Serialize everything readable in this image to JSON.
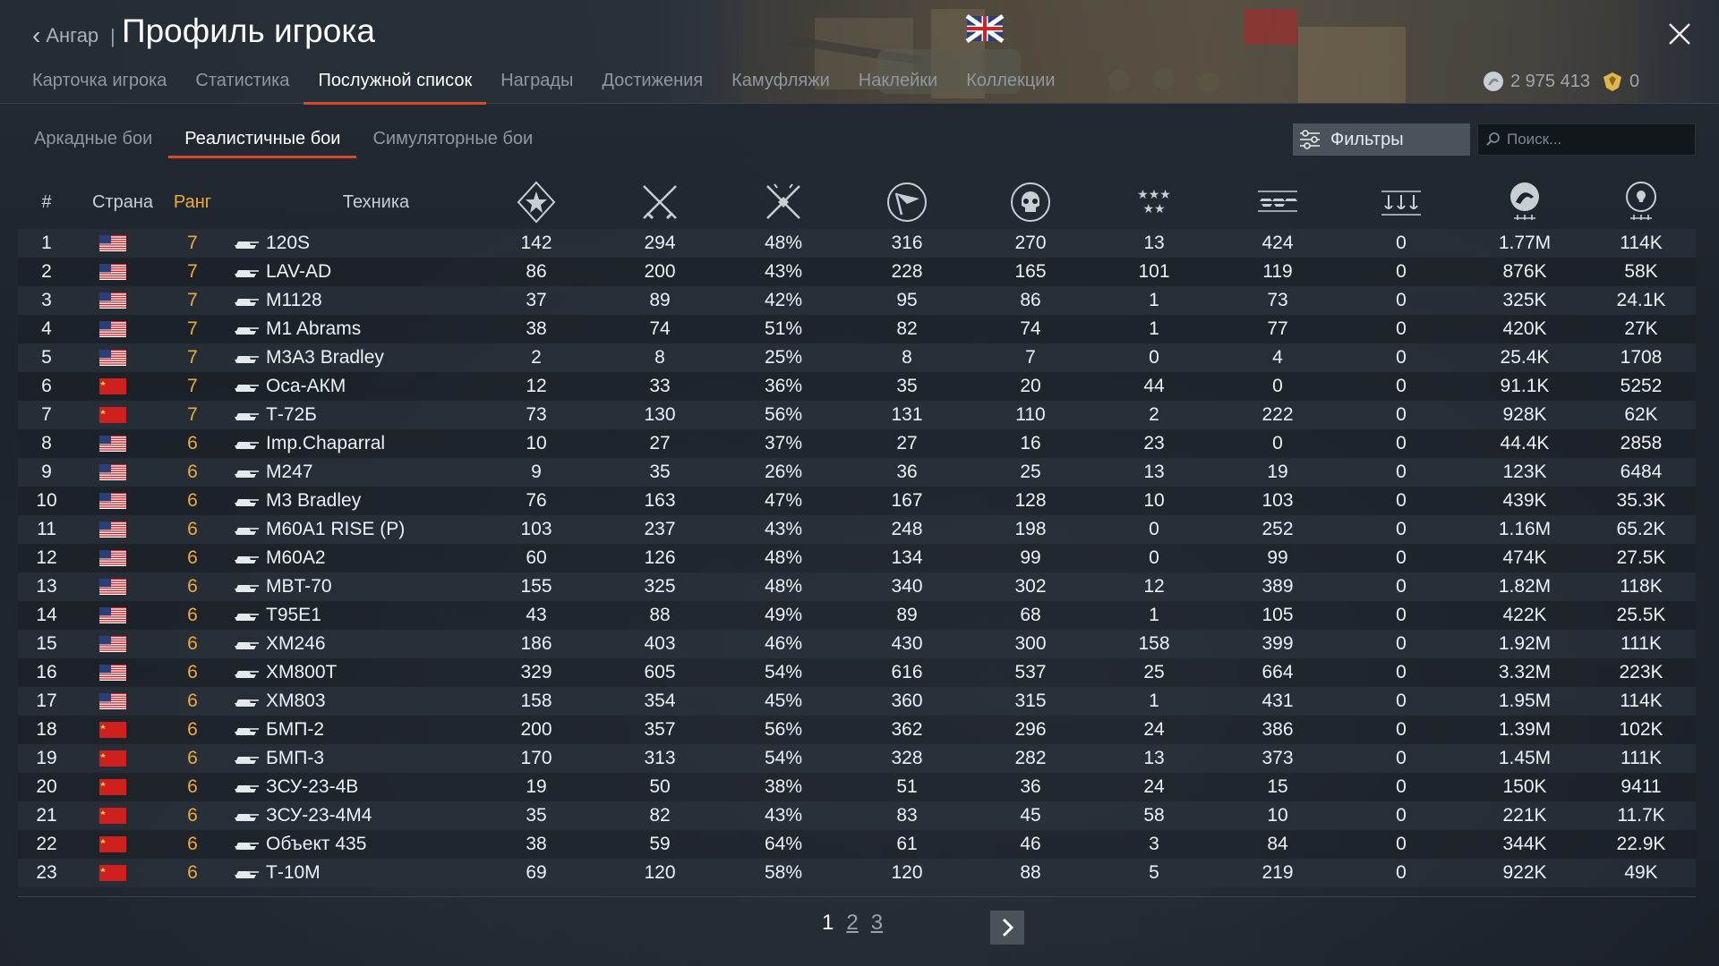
{
  "header": {
    "back_label": "Ангар",
    "separator": "|",
    "title": "Профиль игрока",
    "tabs": [
      {
        "label": "Карточка игрока",
        "active": false
      },
      {
        "label": "Статистика",
        "active": false
      },
      {
        "label": "Послужной список",
        "active": true
      },
      {
        "label": "Награды",
        "active": false
      },
      {
        "label": "Достижения",
        "active": false
      },
      {
        "label": "Камуфляжи",
        "active": false
      },
      {
        "label": "Наклейки",
        "active": false
      },
      {
        "label": "Коллекции",
        "active": false
      }
    ],
    "silver_lions": "2 975 413",
    "golden_eagles": "0"
  },
  "subtabs": [
    {
      "label": "Аркадные бои",
      "active": false
    },
    {
      "label": "Реалистичные бои",
      "active": true
    },
    {
      "label": "Симуляторные бои",
      "active": false
    }
  ],
  "filters_label": "Фильтры",
  "search_placeholder": "Поиск...",
  "columns": {
    "num": "#",
    "country": "Страна",
    "rank": "Ранг",
    "vehicle": "Техника",
    "stat_icons": [
      "missions-star-icon",
      "crossed-swords-icon",
      "winrate-swords-icon",
      "respawns-flag-icon",
      "deaths-skull-icon",
      "air-kills-stars-icon",
      "ground-kills-tanks-icon",
      "naval-kills-anchors-icon",
      "silver-lions-icon",
      "research-points-icon"
    ]
  },
  "rows": [
    {
      "n": "1",
      "country": "usa",
      "rank": "7",
      "name": "120S",
      "v": [
        "142",
        "294",
        "48%",
        "316",
        "270",
        "13",
        "424",
        "0",
        "1.77M",
        "114K"
      ]
    },
    {
      "n": "2",
      "country": "usa",
      "rank": "7",
      "name": "LAV-AD",
      "v": [
        "86",
        "200",
        "43%",
        "228",
        "165",
        "101",
        "119",
        "0",
        "876K",
        "58K"
      ]
    },
    {
      "n": "3",
      "country": "usa",
      "rank": "7",
      "name": "M1128",
      "v": [
        "37",
        "89",
        "42%",
        "95",
        "86",
        "1",
        "73",
        "0",
        "325K",
        "24.1K"
      ]
    },
    {
      "n": "4",
      "country": "usa",
      "rank": "7",
      "name": "M1 Abrams",
      "v": [
        "38",
        "74",
        "51%",
        "82",
        "74",
        "1",
        "77",
        "0",
        "420K",
        "27K"
      ]
    },
    {
      "n": "5",
      "country": "usa",
      "rank": "7",
      "name": "M3A3 Bradley",
      "v": [
        "2",
        "8",
        "25%",
        "8",
        "7",
        "0",
        "4",
        "0",
        "25.4K",
        "1708"
      ]
    },
    {
      "n": "6",
      "country": "ussr",
      "rank": "7",
      "name": "Оса-АКМ",
      "v": [
        "12",
        "33",
        "36%",
        "35",
        "20",
        "44",
        "0",
        "0",
        "91.1K",
        "5252"
      ]
    },
    {
      "n": "7",
      "country": "ussr",
      "rank": "7",
      "name": "Т-72Б",
      "v": [
        "73",
        "130",
        "56%",
        "131",
        "110",
        "2",
        "222",
        "0",
        "928K",
        "62K"
      ]
    },
    {
      "n": "8",
      "country": "usa",
      "rank": "6",
      "name": "Imp.Chaparral",
      "v": [
        "10",
        "27",
        "37%",
        "27",
        "16",
        "23",
        "0",
        "0",
        "44.4K",
        "2858"
      ]
    },
    {
      "n": "9",
      "country": "usa",
      "rank": "6",
      "name": "M247",
      "v": [
        "9",
        "35",
        "26%",
        "36",
        "25",
        "13",
        "19",
        "0",
        "123K",
        "6484"
      ]
    },
    {
      "n": "10",
      "country": "usa",
      "rank": "6",
      "name": "M3 Bradley",
      "v": [
        "76",
        "163",
        "47%",
        "167",
        "128",
        "10",
        "103",
        "0",
        "439K",
        "35.3K"
      ]
    },
    {
      "n": "11",
      "country": "usa",
      "rank": "6",
      "name": "M60A1 RISE (P)",
      "v": [
        "103",
        "237",
        "43%",
        "248",
        "198",
        "0",
        "252",
        "0",
        "1.16M",
        "65.2K"
      ]
    },
    {
      "n": "12",
      "country": "usa",
      "rank": "6",
      "name": "M60A2",
      "v": [
        "60",
        "126",
        "48%",
        "134",
        "99",
        "0",
        "99",
        "0",
        "474K",
        "27.5K"
      ]
    },
    {
      "n": "13",
      "country": "usa",
      "rank": "6",
      "name": "MBT-70",
      "v": [
        "155",
        "325",
        "48%",
        "340",
        "302",
        "12",
        "389",
        "0",
        "1.82M",
        "118K"
      ]
    },
    {
      "n": "14",
      "country": "usa",
      "rank": "6",
      "name": "T95E1",
      "v": [
        "43",
        "88",
        "49%",
        "89",
        "68",
        "1",
        "105",
        "0",
        "422K",
        "25.5K"
      ]
    },
    {
      "n": "15",
      "country": "usa",
      "rank": "6",
      "name": "XM246",
      "v": [
        "186",
        "403",
        "46%",
        "430",
        "300",
        "158",
        "399",
        "0",
        "1.92M",
        "111K"
      ]
    },
    {
      "n": "16",
      "country": "usa",
      "rank": "6",
      "name": "XM800T",
      "v": [
        "329",
        "605",
        "54%",
        "616",
        "537",
        "25",
        "664",
        "0",
        "3.32M",
        "223K"
      ]
    },
    {
      "n": "17",
      "country": "usa",
      "rank": "6",
      "name": "XM803",
      "v": [
        "158",
        "354",
        "45%",
        "360",
        "315",
        "1",
        "431",
        "0",
        "1.95M",
        "114K"
      ]
    },
    {
      "n": "18",
      "country": "ussr",
      "rank": "6",
      "name": "БМП-2",
      "v": [
        "200",
        "357",
        "56%",
        "362",
        "296",
        "24",
        "386",
        "0",
        "1.39M",
        "102K"
      ]
    },
    {
      "n": "19",
      "country": "ussr",
      "rank": "6",
      "name": "БМП-3",
      "v": [
        "170",
        "313",
        "54%",
        "328",
        "282",
        "13",
        "373",
        "0",
        "1.45M",
        "111K"
      ]
    },
    {
      "n": "20",
      "country": "ussr",
      "rank": "6",
      "name": "ЗСУ-23-4В",
      "v": [
        "19",
        "50",
        "38%",
        "51",
        "36",
        "24",
        "15",
        "0",
        "150K",
        "9411"
      ]
    },
    {
      "n": "21",
      "country": "ussr",
      "rank": "6",
      "name": "ЗСУ-23-4М4",
      "v": [
        "35",
        "82",
        "43%",
        "83",
        "45",
        "58",
        "10",
        "0",
        "221K",
        "11.7K"
      ]
    },
    {
      "n": "22",
      "country": "ussr",
      "rank": "6",
      "name": "Объект 435",
      "v": [
        "38",
        "59",
        "64%",
        "61",
        "46",
        "3",
        "84",
        "0",
        "344K",
        "22.9K"
      ]
    },
    {
      "n": "23",
      "country": "ussr",
      "rank": "6",
      "name": "Т-10М",
      "v": [
        "69",
        "120",
        "58%",
        "120",
        "88",
        "5",
        "219",
        "0",
        "922K",
        "49K"
      ]
    }
  ],
  "pagination": {
    "pages": [
      "1",
      "2",
      "3"
    ],
    "current": "1"
  },
  "colors": {
    "accent": "#d84a2a",
    "rank": "#f0a93c"
  }
}
